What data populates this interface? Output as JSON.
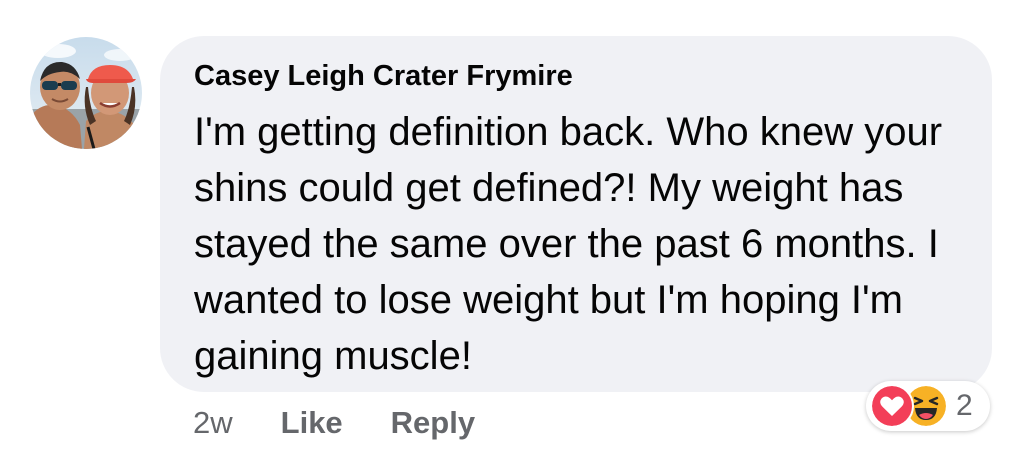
{
  "comment": {
    "author": "Casey Leigh Crater Frymire",
    "text": "I'm getting definition back. Who knew your shins could get defined?! My weight has stayed the same over the past 6 months. I wanted to lose weight but I'm hoping I'm gaining muscle!",
    "timestamp": "2w",
    "like_label": "Like",
    "reply_label": "Reply"
  },
  "reactions": {
    "icons": [
      "love-icon",
      "haha-icon"
    ],
    "count": "2"
  },
  "colors": {
    "bubble_bg": "#f0f1f5",
    "text_primary": "#050505",
    "text_secondary": "#65676b",
    "love_red": "#f33e58",
    "haha_yellow": "#f7b125"
  }
}
